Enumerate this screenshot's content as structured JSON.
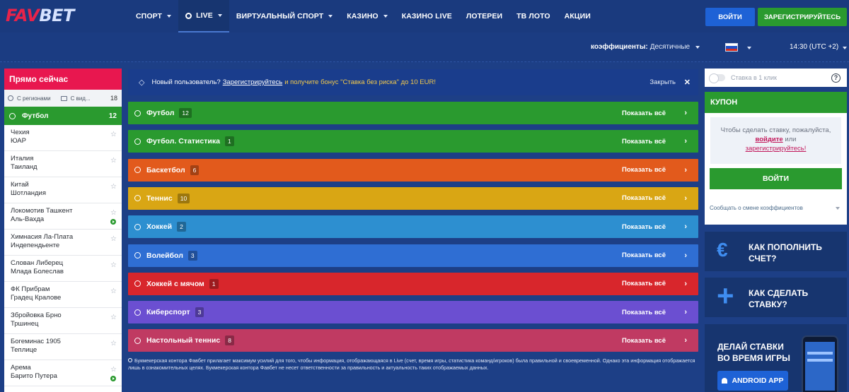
{
  "logo": {
    "fav": "FAV",
    "bet": "BET"
  },
  "nav": [
    {
      "label": "СПОРТ",
      "caret": true
    },
    {
      "label": "LIVE",
      "caret": true,
      "active": true
    },
    {
      "label": "ВИРТУАЛЬНЫЙ СПОРТ",
      "caret": true
    },
    {
      "label": "КАЗИНО",
      "caret": true
    },
    {
      "label": "КАЗИНО LIVE",
      "caret": false
    },
    {
      "label": "ЛОТЕРЕИ",
      "caret": false
    },
    {
      "label": "ТВ ЛОТО",
      "caret": false
    },
    {
      "label": "АКЦИИ",
      "caret": false
    }
  ],
  "auth": {
    "login": "ВОЙТИ",
    "register": "ЗАРЕГИСТРИРУЙТЕСЬ"
  },
  "subbar": {
    "odds_label": "коэффициенты:",
    "odds_value": "Десятичные",
    "time": "14:30 (UTC +2)"
  },
  "sidebar": {
    "title": "Прямо сейчас",
    "filter_regions": "С регионами",
    "filter_video": "С вид...",
    "filter_count": "18",
    "sport": "Футбол",
    "sport_count": "12",
    "matches": [
      {
        "team1": "Чехия",
        "team2": "ЮАР",
        "live": false
      },
      {
        "team1": "Италия",
        "team2": "Таиланд",
        "live": false
      },
      {
        "team1": "Китай",
        "team2": "Шотландия",
        "live": false
      },
      {
        "team1": "Локомотив Ташкент",
        "team2": "Аль-Вахда",
        "live": true
      },
      {
        "team1": "Химнасия Ла-Плата",
        "team2": "Индепендьенте",
        "live": false
      },
      {
        "team1": "Слован Либерец",
        "team2": "Млада Болеслав",
        "live": false
      },
      {
        "team1": "ФК Прибрам",
        "team2": "Градец Кралове",
        "live": false
      },
      {
        "team1": "Збройовка Брно",
        "team2": "Тршинец",
        "live": false
      },
      {
        "team1": "Богеминас 1905",
        "team2": "Теплице",
        "live": false
      },
      {
        "team1": "Арема",
        "team2": "Барито Путера",
        "live": true
      }
    ]
  },
  "banner": {
    "text1": "Новый пользователь?",
    "link": "Зарегистрируйтесь",
    "text2": "и получите бонус",
    "bonus": "\"Ставка без риска\" до 10 EUR!",
    "close": "Закрыть"
  },
  "show_all_label": "Показать всё",
  "sports": [
    {
      "name": "Футбол",
      "count": "12",
      "color": "#2a9a2f"
    },
    {
      "name": "Футбол. Статистика",
      "count": "1",
      "color": "#2a9a2f"
    },
    {
      "name": "Баскетбол",
      "count": "6",
      "color": "#e25a1c"
    },
    {
      "name": "Теннис",
      "count": "10",
      "color": "#d9a614"
    },
    {
      "name": "Хоккей",
      "count": "2",
      "color": "#2d8fd0"
    },
    {
      "name": "Волейбол",
      "count": "3",
      "color": "#2f6ed3"
    },
    {
      "name": "Хоккей с мячом",
      "count": "1",
      "color": "#d8262c"
    },
    {
      "name": "Киберспорт",
      "count": "3",
      "color": "#6b4fd1"
    },
    {
      "name": "Настольный теннис",
      "count": "8",
      "color": "#c03a62"
    }
  ],
  "disclaimer": "Букмекерская контора Фавбет прилагает максимум усилий для того, чтобы информация, отображающаяся в Live (счет, время игры, статистика команд/игроков) была правильной и своевременной. Однако эта информация отображается лишь в ознакомительных целях. Букмекерская контора Фавбет не несет ответственности за правильность и актуальность таких отображаемых данных.",
  "right": {
    "one_click": "Ставка в 1 клик",
    "coupon_title": "КУПОН",
    "coupon_msg1": "Чтобы сделать ставку, пожалуйста,",
    "coupon_link1": "войдите",
    "coupon_or": "или",
    "coupon_link2": "зарегистрируйтесь!",
    "coupon_login": "ВОЙТИ",
    "notify": "Сообщать о смене коэффициентов",
    "promo1": {
      "line1": "КАК ПОПОЛНИТЬ",
      "line2": "СЧЕТ?"
    },
    "promo2": {
      "line1": "КАК СДЕЛАТЬ",
      "line2": "СТАВКУ?"
    },
    "promo3": {
      "line1": "ДЕЛАЙ СТАВКИ",
      "line2": "ВО ВРЕМЯ ИГРЫ",
      "button": "ANDROID APP"
    }
  }
}
